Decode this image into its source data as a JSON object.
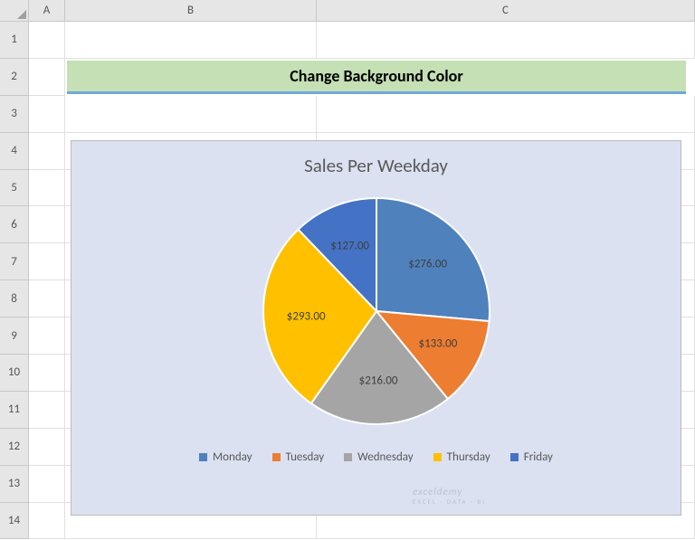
{
  "columns": [
    "A",
    "B",
    "C"
  ],
  "rows": [
    "1",
    "2",
    "3",
    "4",
    "5",
    "6",
    "7",
    "8",
    "9",
    "10",
    "11",
    "12",
    "13",
    "14"
  ],
  "header_title": "Change Background Color",
  "chart_data": {
    "type": "pie",
    "title": "Sales Per Weekday",
    "categories": [
      "Monday",
      "Tuesday",
      "Wednesday",
      "Thursday",
      "Friday"
    ],
    "values": [
      276,
      133,
      216,
      293,
      127
    ],
    "labels": [
      "$276.00",
      "$133.00",
      "$216.00",
      "$293.00",
      "$127.00"
    ],
    "colors": [
      "#4f81bd",
      "#ed7d31",
      "#a5a5a5",
      "#ffc000",
      "#4472c4"
    ]
  },
  "watermark": {
    "main": "exceldemy",
    "sub": "EXCEL · DATA · BI"
  }
}
